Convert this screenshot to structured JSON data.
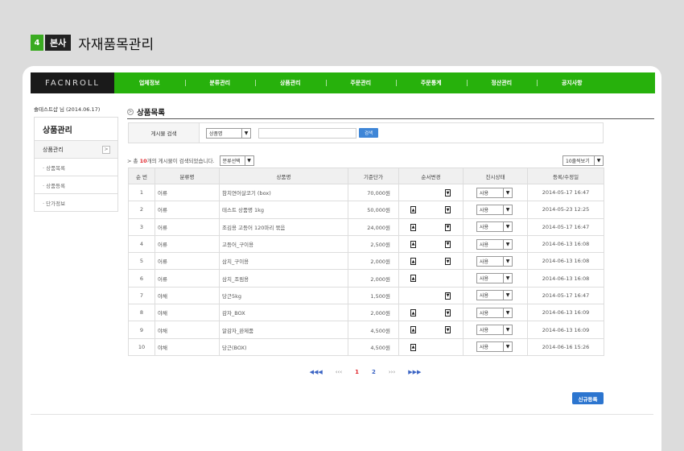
{
  "header": {
    "step_number": "4",
    "step_label": "본사",
    "page_title": "자재품목관리"
  },
  "gnb": {
    "logo": "FACNROLL",
    "menu": [
      "업체정보",
      "분류관리",
      "상품관리",
      "주문관리",
      "주문통계",
      "정산관리",
      "공지사항"
    ]
  },
  "user_info": "솔테스트샵 님 (2014.06.17)",
  "lnb": {
    "title": "상품관리",
    "section": "상품관리",
    "section_arrow": ">",
    "items": [
      "· 상품목록",
      "· 상품등록",
      "· 단가정보"
    ]
  },
  "content": {
    "section_title": "상품목록",
    "search": {
      "label": "게시물 검색",
      "field_select": "상품명",
      "button": "검색"
    },
    "count": {
      "prefix": "> 총 ",
      "number": "10",
      "suffix": "개의 게시물이 검색되었습니다."
    },
    "category_filter": "분류선택",
    "page_size": "10줄씩보기",
    "table": {
      "headers": [
        "순 번",
        "분류명",
        "상품명",
        "기준단가",
        "순서변경",
        "진시상태",
        "등록/수정일"
      ],
      "rows": [
        {
          "no": "1",
          "category": "어류",
          "name": "참치연어살코기 (box)",
          "price": "70,000원",
          "up": false,
          "down": true,
          "status": "사용",
          "date": "2014-05-17  16:47"
        },
        {
          "no": "2",
          "category": "어류",
          "name": "테스트 상품명 1kg",
          "price": "50,000원",
          "up": true,
          "down": true,
          "status": "사용",
          "date": "2014-05-23  12:25"
        },
        {
          "no": "3",
          "category": "어류",
          "name": "조김용 고등어 120마리 묶음",
          "price": "24,000원",
          "up": true,
          "down": true,
          "status": "사용",
          "date": "2014-05-17  16:47"
        },
        {
          "no": "4",
          "category": "어류",
          "name": "고등어_구이용",
          "price": "2,500원",
          "up": true,
          "down": true,
          "status": "사용",
          "date": "2014-06-13  16:08"
        },
        {
          "no": "5",
          "category": "어류",
          "name": "삼치_구이용",
          "price": "2,000원",
          "up": true,
          "down": true,
          "status": "사용",
          "date": "2014-06-13  16:08"
        },
        {
          "no": "6",
          "category": "어류",
          "name": "삼치_조림용",
          "price": "2,000원",
          "up": true,
          "down": false,
          "status": "사용",
          "date": "2014-06-13  16:08"
        },
        {
          "no": "7",
          "category": "야채",
          "name": "당근5kg",
          "price": "1,500원",
          "up": false,
          "down": true,
          "status": "사용",
          "date": "2014-05-17  16:47"
        },
        {
          "no": "8",
          "category": "야채",
          "name": "감자_BOX",
          "price": "2,000원",
          "up": true,
          "down": true,
          "status": "사용",
          "date": "2014-06-13  16:09"
        },
        {
          "no": "9",
          "category": "야채",
          "name": "알감자_완제품",
          "price": "4,500원",
          "up": true,
          "down": true,
          "status": "사용",
          "date": "2014-06-13  16:09"
        },
        {
          "no": "10",
          "category": "야채",
          "name": "당근(BOX)",
          "price": "4,500원",
          "up": true,
          "down": false,
          "status": "사용",
          "date": "2014-06-16  15:26"
        }
      ]
    },
    "pagination": {
      "first": "◀◀◀",
      "prev": "‹‹‹",
      "pages": [
        "1",
        "2"
      ],
      "current": "1",
      "next": "›››",
      "last": "▶▶▶"
    },
    "register_button": "신규등록"
  },
  "colors": {
    "gnb_green": "#27b10c",
    "step_green": "#3aab21",
    "accent_blue": "#2c75cf",
    "count_red": "#e0262c"
  }
}
